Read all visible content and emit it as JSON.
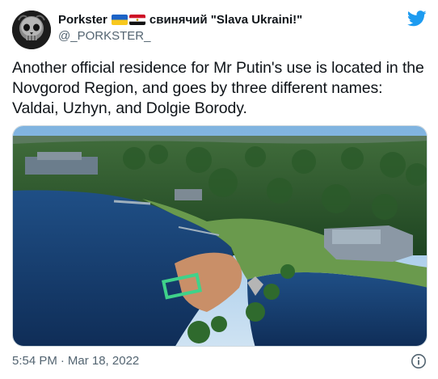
{
  "author": {
    "display_name": "Porkster",
    "name_suffix": "свинячий \"Slava Ukraini!\"",
    "handle": "@_PORKSTER_",
    "avatar_icon": "skull-avatar-icon",
    "flags": [
      "ukraine-flag-icon",
      "egypt-flag-icon"
    ]
  },
  "tweet": {
    "text": "Another official residence for Mr Putin's use is located in the Novgorod Region, and goes by three different names: Valdai, Uzhyn, and Dolgie Borody."
  },
  "footer": {
    "time": "5:54 PM",
    "separator": "·",
    "date": "Mar 18, 2022"
  },
  "icons": {
    "brand": "twitter-bird-icon",
    "info": "info-icon"
  },
  "colors": {
    "brand_blue": "#1d9bf0",
    "text_primary": "#0f1419",
    "text_secondary": "#536471"
  }
}
